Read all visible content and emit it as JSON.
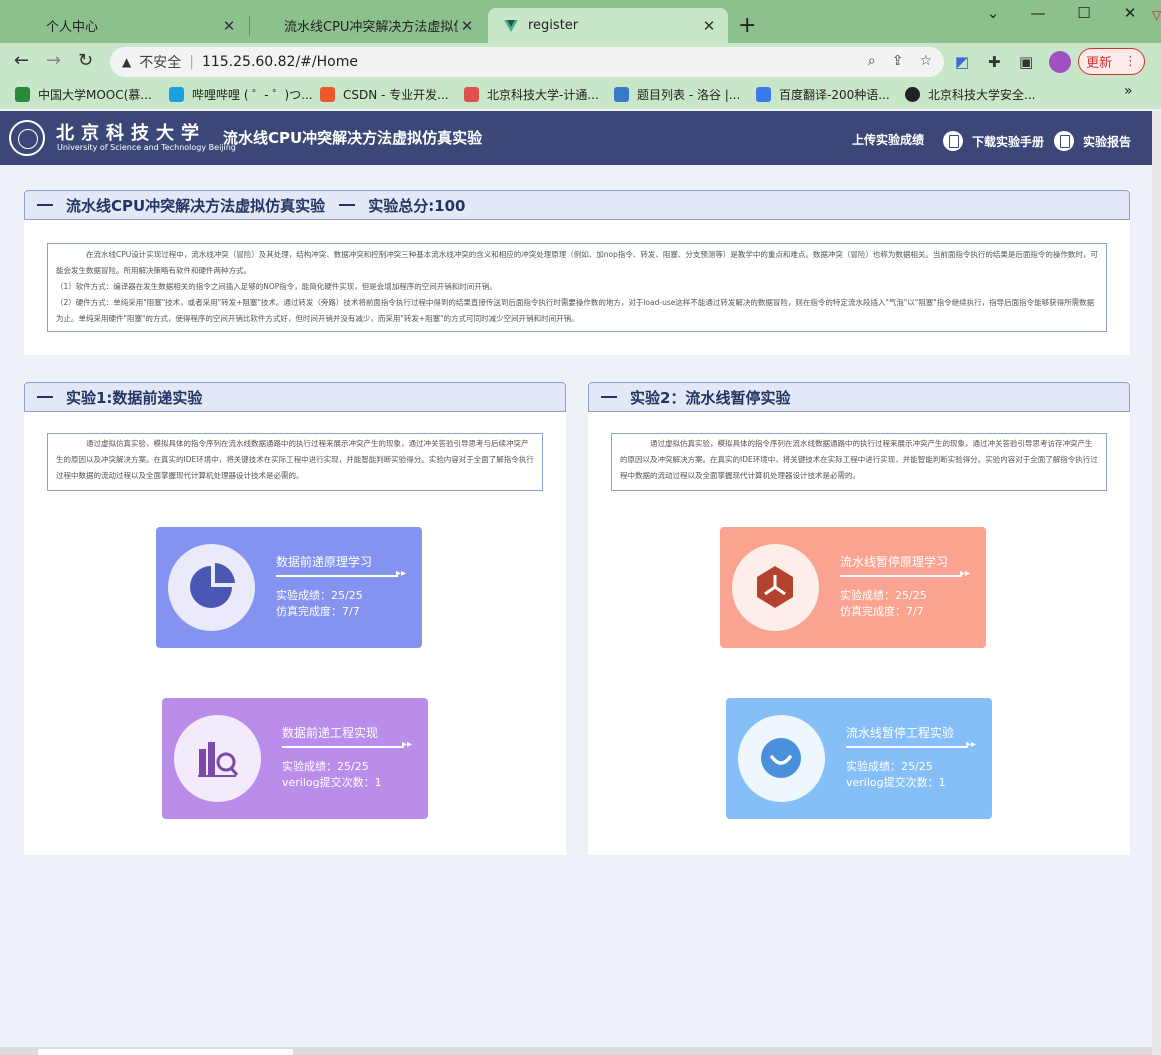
{
  "browser": {
    "tabs": [
      {
        "title": "个人中心"
      },
      {
        "title": "流水线CPU冲突解决方法虚拟仿真"
      },
      {
        "title": "register"
      }
    ],
    "address": {
      "warning": "不安全",
      "url": "115.25.60.82/#/Home"
    },
    "update_label": "更新",
    "bookmarks": [
      {
        "label": "中国大学MOOC(慕...",
        "color": "#2a8a3a"
      },
      {
        "label": "哔哩哔哩 ( ゜- ゜)つ...",
        "color": "#1aa0e0"
      },
      {
        "label": "CSDN - 专业开发...",
        "color": "#e85a2a"
      },
      {
        "label": "北京科技大学-计通...",
        "color": "#e05050"
      },
      {
        "label": "题目列表 - 洛谷 |...",
        "color": "#3a78c8"
      },
      {
        "label": "百度翻译-200种语...",
        "color": "#3a7ae8"
      },
      {
        "label": "北京科技大学安全...",
        "color": "#222222"
      }
    ],
    "bookmarks_more": "»"
  },
  "header": {
    "logo_cn": "北京科技大学",
    "logo_en": "University of Science and Technology Beijing",
    "title": "流水线CPU冲突解决方法虚拟仿真实验",
    "links": {
      "upload": "上传实验成绩",
      "manual": "下载实验手册",
      "report": "实验报告"
    }
  },
  "overview": {
    "title": "流水线CPU冲突解决方法虚拟仿真实验",
    "score_label": "实验总分:100",
    "para1": "在流水线CPU设计实现过程中，流水线冲突（冒险）及其处理，结构冲突、数据冲突和控制冲突三种基本流水线冲突的含义和相应的冲突处理原理（例如、加nop指令、转发、阻塞、分支预测等）是教学中的重点和难点。数据冲突（冒险）也称为数据相关。当前面指令执行的结果是后面指令的操作数时，可能会发生数据冒险。所用解决策略有软件和硬件两种方式。",
    "para2": "（1）软件方式：编译器在发生数据相关的指令之间插入足够的NOP指令，能简化硬件实现，但是会增加程序的空间开销和时间开销。",
    "para3": "（2）硬件方式：单纯采用\"阻塞\"技术，或者采用\"转发+阻塞\"技术。通过转发（旁路）技术将前面指令执行过程中得到的结果直接传送到后面指令执行时需要操作数的地方，对于load-use这样不能通过转发解决的数据冒险，则在指令的特定流水段插入\"气泡\"以\"阻塞\"指令继续执行，指导后面指令能够获得所需数据为止。单纯采用硬件\"阻塞\"的方式，使得程序的空间开销比软件方式好，但时间开销并没有减少，而采用\"转发+阻塞\"的方式可同时减少空间开销和时间开销。"
  },
  "exp1": {
    "title": "实验1:数据前递实验",
    "desc": "通过虚拟仿真实验，模拟具体的指令序列在流水线数据通路中的执行过程来展示冲突产生的现象，通过冲关答验引导思考与后续冲突产生的原因以及冲突解决方案。在真实的IDE环境中，将关键技术在实际工程中进行实现，并能智能判断实验得分。实验内容对于全面了解指令执行过程中数据的流动过程以及全面掌握现代计算机处理器设计技术是必需的。",
    "card1": {
      "title": "数据前递原理学习",
      "line1": "实验成绩：25/25",
      "line2": "仿真完成度：7/7",
      "bg": "#8493ef",
      "icon": "pie-chart-icon"
    },
    "card2": {
      "title": "数据前递工程实现",
      "line1": "实验成绩：25/25",
      "line2": "verilog提交次数：1",
      "bg": "#bb8deb",
      "icon": "data-search-icon"
    }
  },
  "exp2": {
    "title": "实验2：流水线暂停实验",
    "desc": "通过虚拟仿真实验，模拟具体的指令序列在流水线数据通路中的执行过程来展示冲突产生的现象，通过冲关答验引导思考访存冲突产生的原因以及冲突解决方案。在真实的IDE环境中，将关键技术在实际工程中进行实现，并能智能判断实验得分。实验内容对于全面了解指令执行过程中数据的流动过程以及全面掌握现代计算机处理器设计技术是必需的。",
    "card1": {
      "title": "流水线暂停原理学习",
      "line1": "实验成绩：25/25",
      "line2": "仿真完成度：7/7",
      "bg": "#fba391",
      "icon": "hexagon-cube-icon"
    },
    "card2": {
      "title": "流水线暂停工程实验",
      "line1": "实验成绩：25/25",
      "line2": "verilog提交次数：1",
      "bg": "#86bff7",
      "icon": "smile-icon"
    }
  }
}
